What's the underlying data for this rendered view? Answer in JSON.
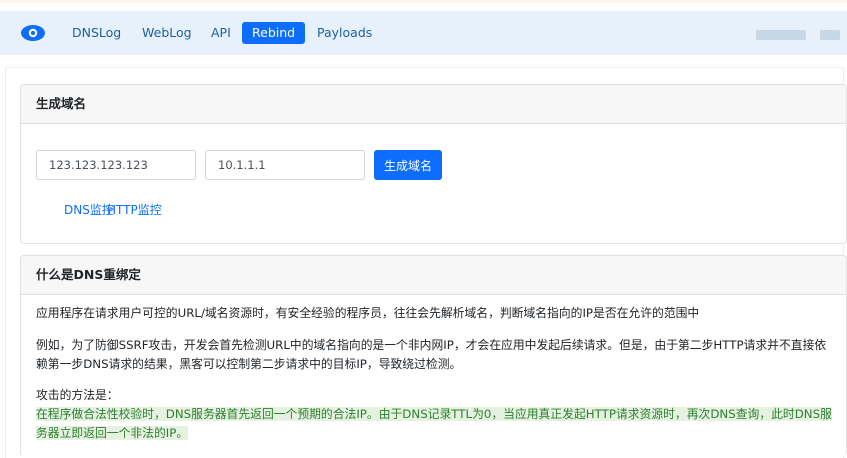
{
  "nav": {
    "items": [
      {
        "label": "DNSLog",
        "active": false
      },
      {
        "label": "WebLog",
        "active": false
      },
      {
        "label": "API",
        "active": false
      },
      {
        "label": "Rebind",
        "active": true
      },
      {
        "label": "Payloads",
        "active": false
      }
    ],
    "brand_icon": "eye-icon",
    "accent": "#0d6efd"
  },
  "generate_card": {
    "title": "生成域名",
    "ip1_value": "123.123.123.123",
    "ip2_value": "10.1.1.1",
    "generate_button": "生成域名",
    "link_dns": "DNS监控",
    "link_http": "HTTP监控"
  },
  "info_card": {
    "title": "什么是DNS重绑定",
    "para1": "应用程序在请求用户可控的URL/域名资源时，有安全经验的程序员，往往会先解析域名，判断域名指向的IP是否在允许的范围中",
    "para2": "例如，为了防御SSRF攻击，开发会首先检测URL中的域名指向的是一个非内网IP，才会在应用中发起后续请求。但是，由于第二步HTTP请求并不直接依赖第一步DNS请求的结果，黑客可以控制第二步请求中的目标IP，导致绕过检测。",
    "method_label": "攻击的方法是：",
    "method_text": "在程序做合法性校验时，DNS服务器首先返回一个预期的合法IP。由于DNS记录TTL为0，当应用真正发起HTTP请求资源时，再次DNS查询，此时DNS服务器立即返回一个非法的IP。"
  }
}
